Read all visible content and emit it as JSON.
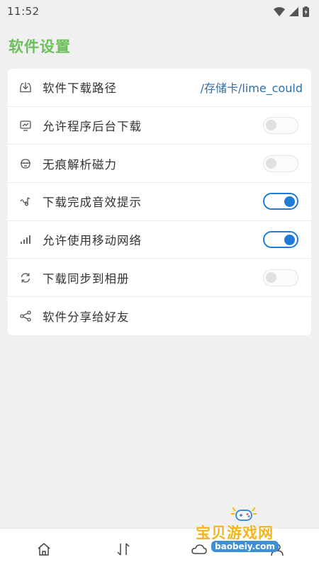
{
  "status_bar": {
    "time": "11:52",
    "icons": [
      "wifi-icon",
      "signal-icon",
      "battery-icon"
    ]
  },
  "page": {
    "title": "软件设置"
  },
  "settings": {
    "rows": [
      {
        "label": "软件下载路径",
        "icon": "download-box-icon",
        "value": "/存储卡/lime_could"
      },
      {
        "label": "允许程序后台下载",
        "icon": "monitor-icon",
        "toggle": false
      },
      {
        "label": "无痕解析磁力",
        "icon": "mask-icon",
        "toggle": false
      },
      {
        "label": "下载完成音效提示",
        "icon": "sound-icon",
        "toggle": true
      },
      {
        "label": "允许使用移动网络",
        "icon": "cell-signal-icon",
        "toggle": true
      },
      {
        "label": "下载同步到相册",
        "icon": "sync-icon",
        "toggle": false
      },
      {
        "label": "软件分享给好友",
        "icon": "share-icon"
      }
    ]
  },
  "bottom_nav": {
    "items": [
      "home-icon",
      "transfer-icon",
      "cloud-icon",
      "profile-icon"
    ]
  },
  "watermark": {
    "main": "宝贝游戏网",
    "sub": "baobeiy.com"
  },
  "colors": {
    "title_green": "#6cbf5a",
    "toggle_blue": "#1e7bd6",
    "path_blue": "#2f6fa8",
    "background": "#f0f0f0"
  }
}
